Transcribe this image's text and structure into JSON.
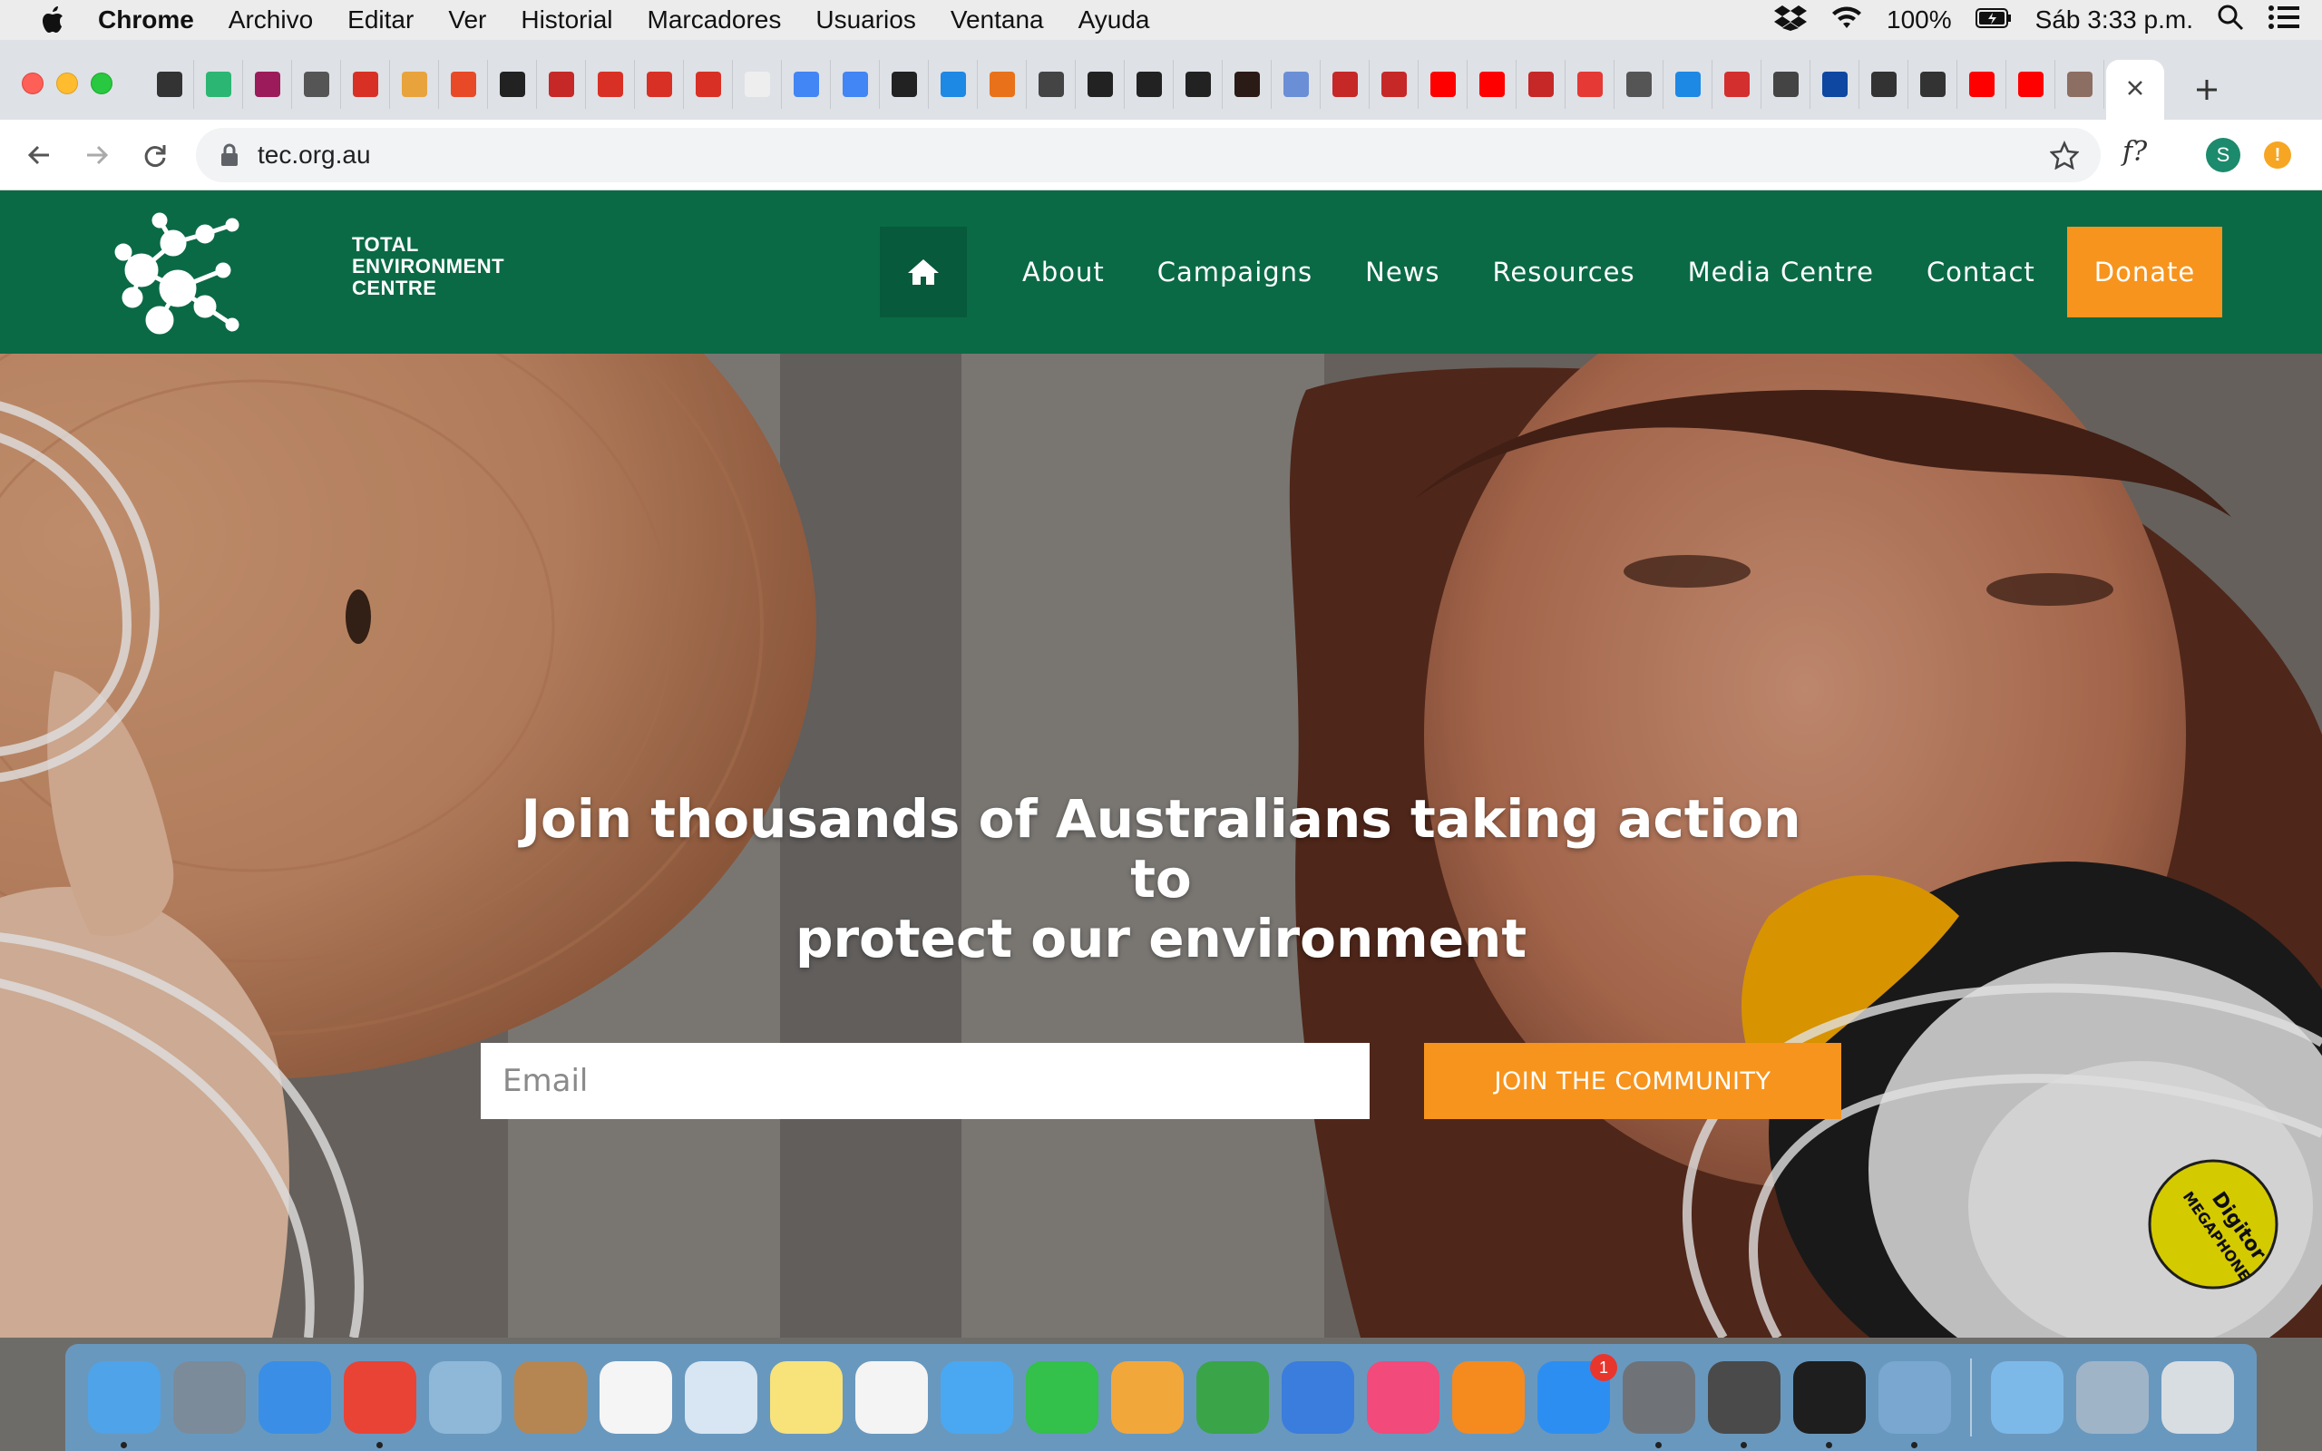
{
  "menubar": {
    "app_name": "Chrome",
    "items": [
      "Archivo",
      "Editar",
      "Ver",
      "Historial",
      "Marcadores",
      "Usuarios",
      "Ventana",
      "Ayuda"
    ],
    "battery": "100%",
    "clock": "Sáb 3:33 p.m."
  },
  "browser": {
    "url": "tec.org.au",
    "extension_label": "f?",
    "profile_initial": "S",
    "update_badge": "!",
    "pinned_tab_colors": [
      "#333333",
      "#2bb673",
      "#9c1b5a",
      "#555555",
      "#d93025",
      "#e8a33d",
      "#e84a27",
      "#222222",
      "#c62828",
      "#d93025",
      "#d93025",
      "#d93025",
      "#eeeeee",
      "#4285f4",
      "#4285f4",
      "#222222",
      "#1e88e5",
      "#e8711a",
      "#444444",
      "#222222",
      "#222222",
      "#222222",
      "#2b1b17",
      "#6b8fd6",
      "#c62828",
      "#c62828",
      "#ff0000",
      "#ff0000",
      "#c62828",
      "#e53935",
      "#555555",
      "#1e88e5",
      "#d32f2f",
      "#444444",
      "#0d47a1",
      "#333333",
      "#333333",
      "#ff0000",
      "#ff0000",
      "#8d6e63"
    ]
  },
  "site": {
    "logo_text": [
      "TOTAL",
      "ENVIRONMENT",
      "CENTRE"
    ],
    "nav": [
      "About",
      "Campaigns",
      "News",
      "Resources",
      "Media Centre",
      "Contact"
    ],
    "donate_label": "Donate",
    "hero_title_line1": "Join thousands of Australians taking action to",
    "hero_title_line2": "protect our environment",
    "email_placeholder": "Email",
    "join_label": "JOIN THE COMMUNITY",
    "megaphone_label_line1": "Digitor",
    "megaphone_label_line2": "MEGAPHONE",
    "colors": {
      "header_green": "#0a6a46",
      "accent_orange": "#f7941d"
    }
  },
  "dock": {
    "items": [
      {
        "name": "finder",
        "color": "#4fa3e8",
        "running": true
      },
      {
        "name": "launchpad",
        "color": "#7c8b99",
        "running": false
      },
      {
        "name": "safari",
        "color": "#3a8ee6",
        "running": false
      },
      {
        "name": "chrome",
        "color": "#e94335",
        "running": true
      },
      {
        "name": "mail-eagle",
        "color": "#8fb8d8",
        "running": false
      },
      {
        "name": "contacts",
        "color": "#b58652",
        "running": false
      },
      {
        "name": "reminders",
        "color": "#f5f5f5",
        "running": false
      },
      {
        "name": "preview-photos",
        "color": "#d7e6f2",
        "running": false
      },
      {
        "name": "notes",
        "color": "#f8e27a",
        "running": false
      },
      {
        "name": "photos",
        "color": "#f4f4f4",
        "running": false
      },
      {
        "name": "messages",
        "color": "#4aa8f2",
        "running": false
      },
      {
        "name": "facetime",
        "color": "#33c04b",
        "running": false
      },
      {
        "name": "pages",
        "color": "#f2a73b",
        "running": false
      },
      {
        "name": "numbers",
        "color": "#39a548",
        "running": false
      },
      {
        "name": "keynote",
        "color": "#3b7ddd",
        "running": false
      },
      {
        "name": "itunes",
        "color": "#f24a7a",
        "running": false
      },
      {
        "name": "ibooks",
        "color": "#f58a1f",
        "running": false
      },
      {
        "name": "app-store",
        "color": "#2d8ef2",
        "running": false,
        "badge": "1"
      },
      {
        "name": "system-preferences",
        "color": "#6f7378",
        "running": true
      },
      {
        "name": "sublime-text",
        "color": "#4a4a4a",
        "running": true
      },
      {
        "name": "terminal",
        "color": "#1e1e1e",
        "running": true
      },
      {
        "name": "image-preview",
        "color": "#7aa7cf",
        "running": true
      },
      {
        "name": "downloads-folder",
        "color": "#7db9e8",
        "running": false
      },
      {
        "name": "documents-stack",
        "color": "#a0b4c8",
        "running": false
      },
      {
        "name": "trash",
        "color": "#d8dde2",
        "running": false
      }
    ]
  }
}
